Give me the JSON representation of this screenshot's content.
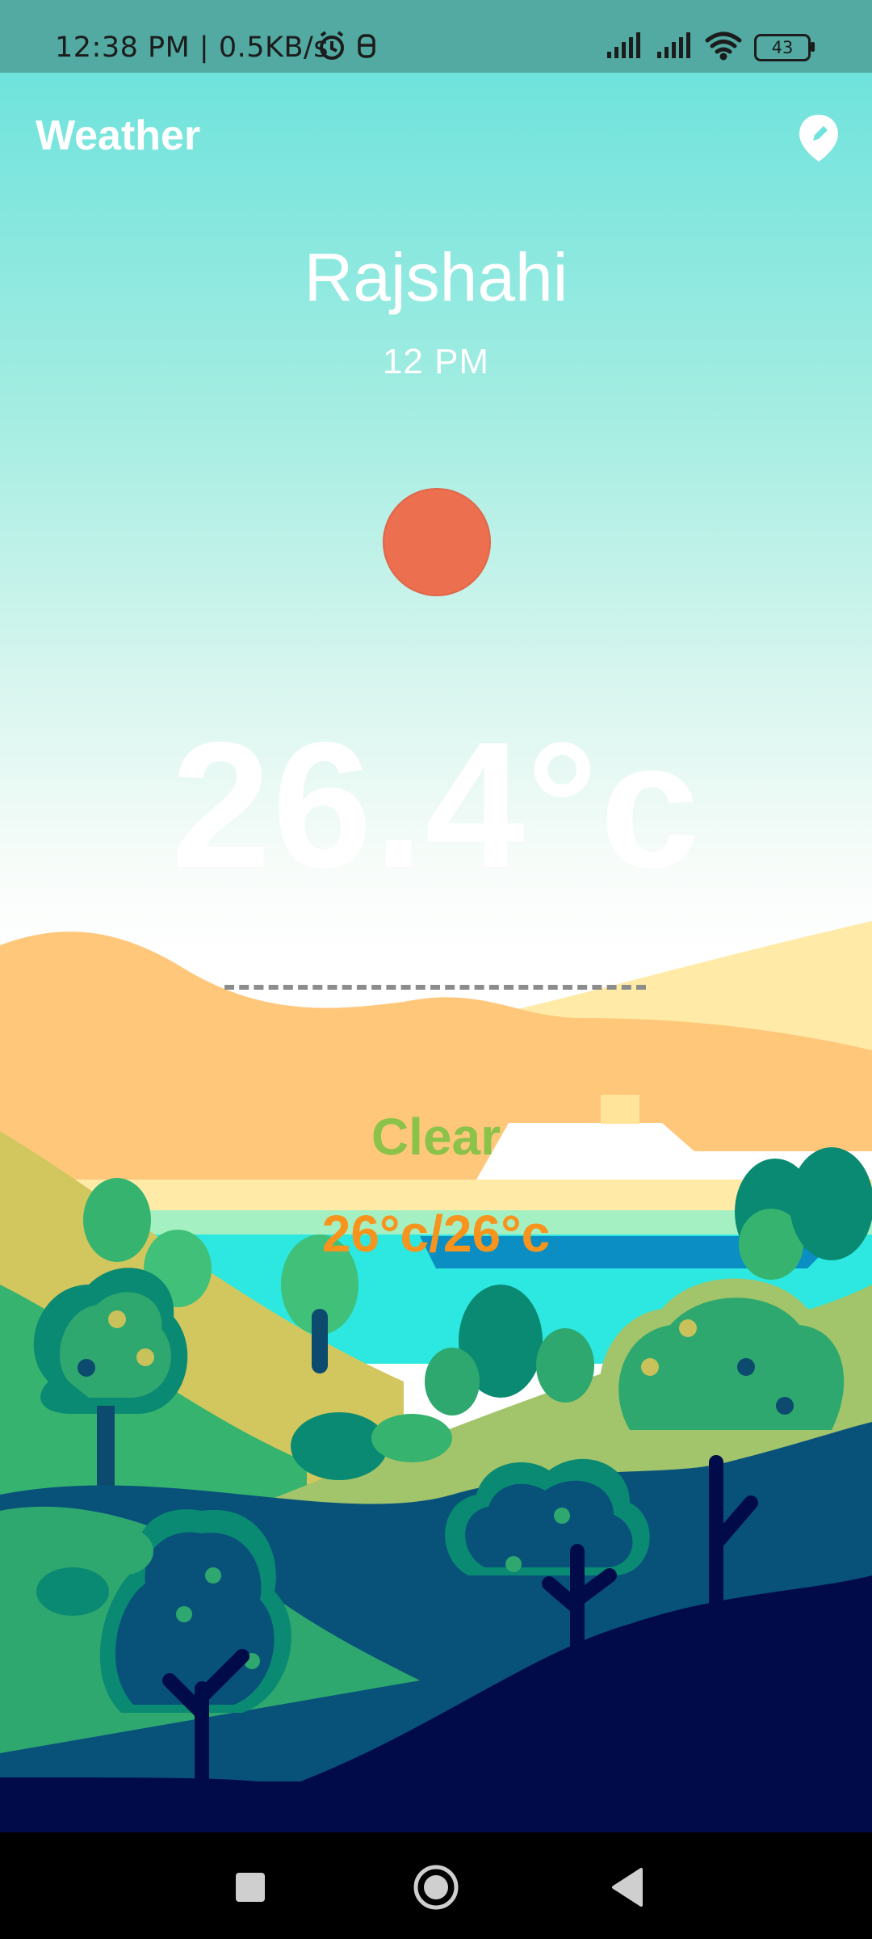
{
  "status_bar": {
    "time_and_speed": "12:38 PM | 0.5KB/s",
    "battery": "43",
    "icons": [
      "alarm-icon",
      "notification-icon",
      "signal-icon",
      "signal-icon",
      "wifi-icon",
      "battery-icon"
    ]
  },
  "app": {
    "title": "Weather",
    "edit_location_icon": "location-edit-icon"
  },
  "weather": {
    "city": "Rajshahi",
    "time": "12 PM",
    "condition_icon": "sun-icon",
    "temperature": "26.4°c",
    "condition": "Clear",
    "range": "26°c/26°c"
  },
  "colors": {
    "condition_text": "#8bc34a",
    "range_text": "#f7941d",
    "sun": "#ec6f4f",
    "status_bar": "#52aaa2"
  },
  "nav_bar": {
    "icons": [
      "recents-icon",
      "home-icon",
      "back-icon"
    ]
  }
}
